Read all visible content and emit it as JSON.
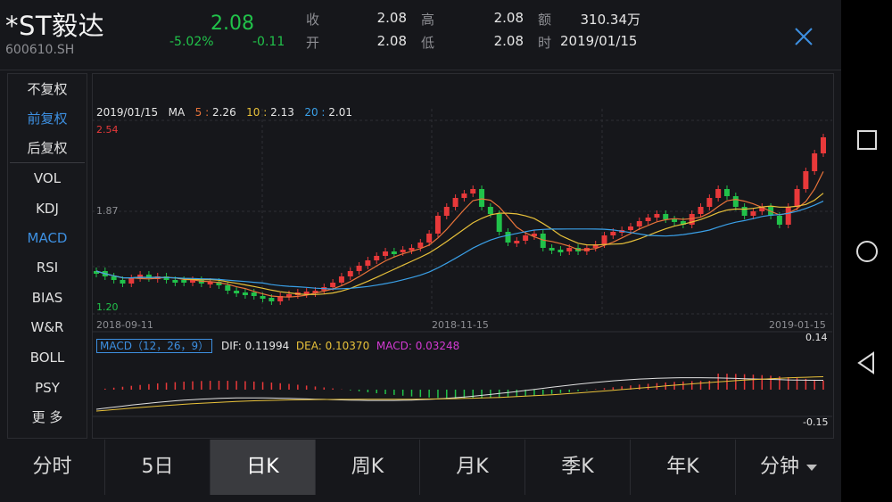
{
  "stock": {
    "name": "*ST毅达",
    "code": "600610.SH",
    "price": "2.08",
    "change_pct": "-5.02%",
    "change_abs": "-0.11"
  },
  "quote": {
    "close_label": "收",
    "close_value": "2.08",
    "high_label": "高",
    "high_value": "2.08",
    "amount_label": "额",
    "amount_value": "310.34万",
    "open_label": "开",
    "open_value": "2.08",
    "low_label": "低",
    "low_value": "2.08",
    "time_label": "时",
    "time_value": "2019/01/15"
  },
  "menu": {
    "items": [
      "不复权",
      "前复权",
      "后复权",
      "VOL",
      "KDJ",
      "MACD",
      "RSI",
      "BIAS",
      "W&R",
      "BOLL",
      "PSY",
      "更 多"
    ],
    "active": [
      "前复权",
      "MACD"
    ]
  },
  "chart": {
    "ma_date": "2019/01/15",
    "ma_label": "MA",
    "ma5_label": "5",
    "ma5_sep": ":",
    "ma5_value": "2.26",
    "ma10_label": "10",
    "ma10_sep": ":",
    "ma10_value": "2.13",
    "ma20_label": "20",
    "ma20_sep": ":",
    "ma20_value": "2.01",
    "y_max": "2.54",
    "y_mid": "1.87",
    "y_min": "1.20",
    "date_start": "2018-09-11",
    "date_mid": "2018-11-15",
    "date_end": "2019-01-15",
    "macd_title": "MACD（12，26，9）",
    "dif_label": "DIF:",
    "dif_value": "0.11994",
    "dea_label": "DEA:",
    "dea_value": "0.10370",
    "macd_label": "MACD:",
    "macd_value": "0.03248",
    "macd_max": "0.14",
    "macd_min": "-0.15",
    "colors": {
      "up": "#e8393a",
      "down": "#21c24a",
      "ma5": "#e8733a",
      "ma10": "#e8c13a",
      "ma20": "#3aa0e8",
      "dif": "#e0e0e0",
      "dea": "#e8c13a",
      "macd": "#d33ad3"
    }
  },
  "chart_data": {
    "type": "candlestick",
    "ylim": [
      1.2,
      2.54
    ],
    "x": [
      "2018-09-11",
      "2018-11-15",
      "2019-01-15"
    ],
    "series": [
      {
        "name": "5",
        "values": [
          2.26
        ]
      },
      {
        "name": "10",
        "values": [
          2.13
        ]
      },
      {
        "name": "20",
        "values": [
          2.01
        ]
      }
    ],
    "macd": {
      "dif": 0.11994,
      "dea": 0.1037,
      "macd": 0.03248,
      "ylim": [
        -0.15,
        0.14
      ]
    }
  },
  "tabs": {
    "items": [
      "分时",
      "5日",
      "日K",
      "周K",
      "月K",
      "季K",
      "年K",
      "分钟"
    ],
    "active": "日K"
  },
  "icons": {
    "close": "close-icon",
    "square": "square-icon",
    "circle": "circle-icon",
    "back": "back-triangle-icon",
    "dropdown": "chevron-down-icon"
  }
}
